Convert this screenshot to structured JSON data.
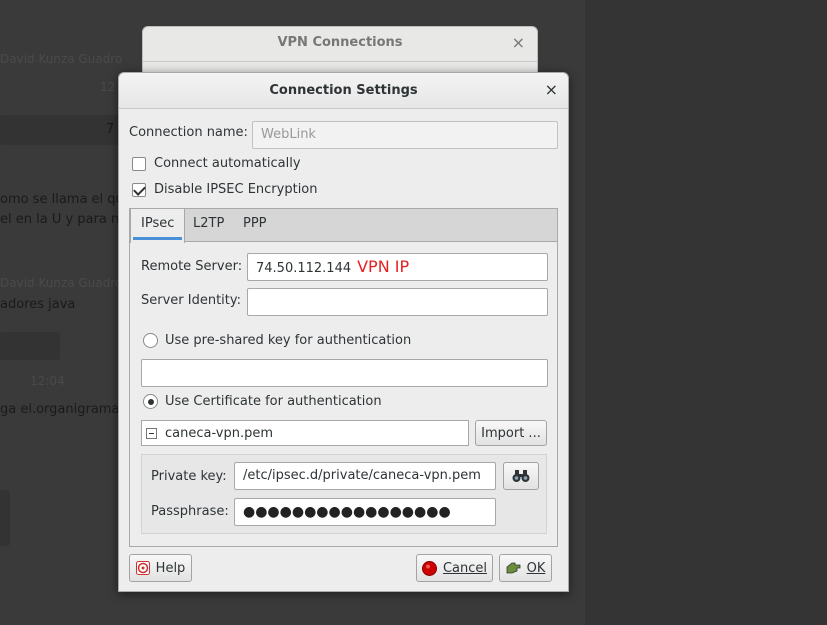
{
  "background": {
    "lines": [
      "David Kunza Guadro",
      "omo se llama el qu",
      "el en la U y para n",
      "David Kunza Guadro",
      "adores java",
      "ga el.organigrama"
    ],
    "times": [
      "12",
      "7",
      "12:04"
    ]
  },
  "vpn_window": {
    "title": "VPN Connections",
    "close": "×"
  },
  "dialog": {
    "title": "Connection Settings",
    "close": "×",
    "connection_name_label": "Connection name:",
    "connection_name_value": "WebLink",
    "connect_auto_label": "Connect automatically",
    "connect_auto_checked": false,
    "disable_ipsec_label": "Disable IPSEC Encryption",
    "disable_ipsec_checked": true,
    "tabs": [
      "IPsec",
      "L2TP",
      "PPP"
    ],
    "active_tab": "IPsec",
    "remote_server_label": "Remote Server:",
    "remote_server_value": "74.50.112.144",
    "annotation": "VPN IP",
    "annotation_color": "#e52222",
    "server_identity_label": "Server Identity:",
    "server_identity_value": "",
    "psk_label": "Use pre-shared key for authentication",
    "psk_value": "",
    "cert_label": "Use Certificate for authentication",
    "cert_file": "caneca-vpn.pem",
    "import_label": "Import ...",
    "private_key_label": "Private key:",
    "private_key_value": "/etc/ipsec.d/private/caneca-vpn.pem",
    "browse_icon": "binoculars-icon",
    "passphrase_label": "Passphrase:",
    "passphrase_value": "●●●●●●●●●●●●●●●●●",
    "help_label": "Help",
    "cancel_label": "Cancel",
    "ok_label": "OK",
    "accent_color": "#4a90d9"
  }
}
